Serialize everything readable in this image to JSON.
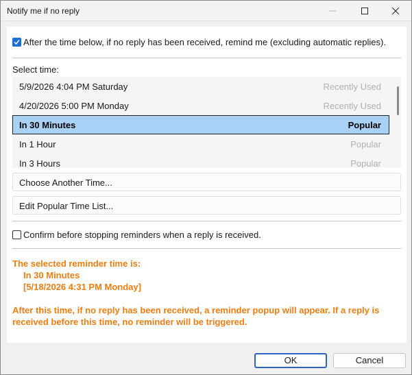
{
  "window": {
    "title": "Notify me if no reply"
  },
  "reminder_option": {
    "checked": true,
    "label": "After the time below, if no reply has been received, remind me (excluding automatic replies)."
  },
  "select_time_label": "Select time:",
  "time_list": [
    {
      "name": "5/9/2026 4:04 PM Saturday",
      "tag": "Recently Used",
      "selected": false
    },
    {
      "name": "4/20/2026 5:00 PM Monday",
      "tag": "Recently Used",
      "selected": false
    },
    {
      "name": "In 30 Minutes",
      "tag": "Popular",
      "selected": true
    },
    {
      "name": "In 1 Hour",
      "tag": "Popular",
      "selected": false
    },
    {
      "name": "In 3 Hours",
      "tag": "Popular",
      "selected": false
    }
  ],
  "buttons": {
    "choose_another": "Choose Another Time...",
    "edit_popular": "Edit Popular Time List...",
    "ok": "OK",
    "cancel": "Cancel"
  },
  "confirm_option": {
    "checked": false,
    "label": "Confirm before stopping reminders when a reply is received."
  },
  "summary": {
    "heading": "The selected reminder time is:",
    "choice": "In 30 Minutes",
    "datetime": "[5/18/2026 4:31 PM Monday]",
    "note_line1": "After this time, if no reply has been received, a reminder popup will appear. If a reply is",
    "note_line2": "received before this time, no reminder will be triggered."
  },
  "colors": {
    "accent": "#1f6fd1",
    "selection": "#a9d0f5",
    "highlight_text": "#f07d10"
  }
}
